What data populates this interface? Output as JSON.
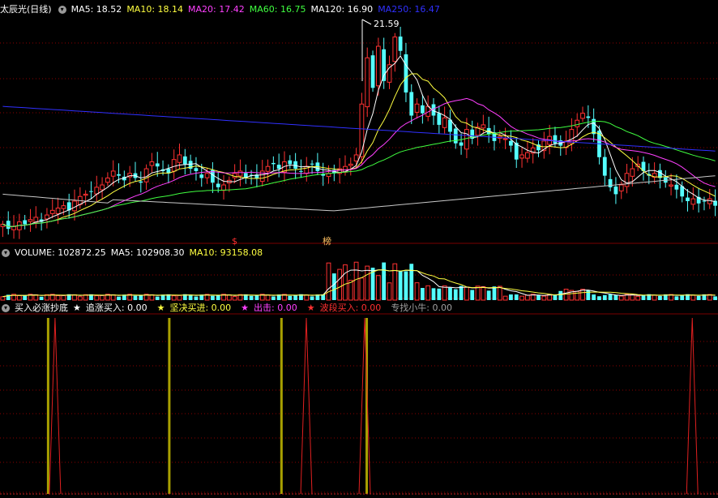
{
  "panel_main": {
    "title": "太辰光(日线)",
    "ma5": "MA5: 18.52",
    "ma10": "MA10: 18.14",
    "ma20": "MA20: 17.42",
    "ma60": "MA60: 16.75",
    "ma120": "MA120: 16.90",
    "ma250": "MA250: 16.47",
    "peak_label": "21.59",
    "marker_s": "$",
    "marker_bang": "榜"
  },
  "panel_volume": {
    "volume": "VOLUME: 102872.25",
    "ma5": "MA5: 102908.30",
    "ma10": "MA10: 93158.08"
  },
  "panel_signal": {
    "title": "买入必涨抄底",
    "star": "★",
    "zhuizhang": "追涨买入: 0.00",
    "jianjue": "坚决买进: 0.00",
    "chuji": "出击: 0.00",
    "boduan": "波段买入: 0.00",
    "zhuanzhao": "专找小牛: 0.00"
  },
  "colors": {
    "up": "#ff3232",
    "down": "#54ffff",
    "ma5": "#ffffff",
    "ma10": "#ffff40",
    "ma20": "#ff40ff",
    "ma60": "#40ff40",
    "ma120": "#c8c8c8",
    "ma250": "#3030ff",
    "grid": "#8b0000",
    "signal_gold": "#a8a000",
    "signal_red": "#e02020"
  },
  "chart_data": [
    {
      "type": "candlestick",
      "title": "太辰光(日线)",
      "series_ma": [
        {
          "name": "MA5",
          "last": 18.52
        },
        {
          "name": "MA10",
          "last": 18.14
        },
        {
          "name": "MA20",
          "last": 17.42
        },
        {
          "name": "MA60",
          "last": 16.75
        },
        {
          "name": "MA120",
          "last": 16.9
        },
        {
          "name": "MA250",
          "last": 16.47
        }
      ],
      "annotations": [
        "21.59"
      ],
      "ylim": [
        13.0,
        22.3
      ],
      "close_path": [
        13.3,
        13.1,
        13.2,
        13.4,
        13.3,
        13.5,
        13.6,
        13.4,
        13.7,
        13.9,
        14.0,
        14.1,
        13.9,
        14.3,
        14.5,
        14.6,
        14.7,
        14.9,
        15.0,
        15.3,
        15.6,
        15.4,
        15.2,
        15.5,
        15.3,
        15.1,
        15.7,
        16.0,
        15.8,
        15.6,
        15.5,
        16.1,
        16.3,
        15.9,
        15.7,
        15.6,
        15.3,
        15.5,
        15.1,
        14.9,
        15.0,
        15.2,
        15.5,
        15.6,
        15.3,
        15.4,
        15.3,
        15.6,
        15.8,
        15.9,
        15.7,
        16.0,
        15.9,
        15.7,
        15.6,
        15.8,
        15.9,
        15.6,
        15.4,
        15.5,
        15.5,
        15.7,
        15.8,
        15.9,
        16.3,
        18.5,
        20.5,
        19.2,
        21.0,
        19.5,
        20.2,
        21.4,
        20.8,
        19.0,
        18.0,
        18.5,
        18.1,
        18.4,
        18.0,
        17.6,
        17.9,
        17.3,
        16.8,
        16.7,
        17.4,
        17.0,
        17.5,
        17.6,
        17.2,
        16.9,
        17.1,
        17.0,
        16.7,
        16.1,
        16.3,
        16.4,
        16.6,
        16.5,
        16.9,
        17.1,
        16.8,
        16.7,
        16.9,
        17.4,
        17.8,
        18.1,
        17.9,
        17.2,
        16.2,
        15.4,
        14.9,
        14.6,
        15.0,
        15.5,
        15.7,
        15.9,
        15.6,
        15.4,
        15.5,
        15.3,
        15.1,
        15.0,
        14.8,
        14.5,
        14.3,
        14.4,
        14.2,
        14.3,
        14.4,
        14.1
      ]
    },
    {
      "type": "bar",
      "title": "VOLUME",
      "series": [
        {
          "name": "VOLUME",
          "last": 102872.25
        },
        {
          "name": "MA5",
          "last": 102908.3
        },
        {
          "name": "MA10",
          "last": 93158.08
        }
      ]
    },
    {
      "type": "line",
      "title": "买入必涨抄底",
      "series": [
        {
          "name": "追涨买入",
          "value": 0.0
        },
        {
          "name": "坚决买进",
          "value": 0.0
        },
        {
          "name": "出击",
          "value": 0.0
        },
        {
          "name": "波段买入",
          "value": 0.0
        },
        {
          "name": "专找小牛",
          "value": 0.0
        }
      ],
      "gold_signal_bars": [
        10,
        37,
        62,
        81
      ],
      "red_spike_bars": [
        11,
        67,
        80,
        153
      ]
    }
  ]
}
